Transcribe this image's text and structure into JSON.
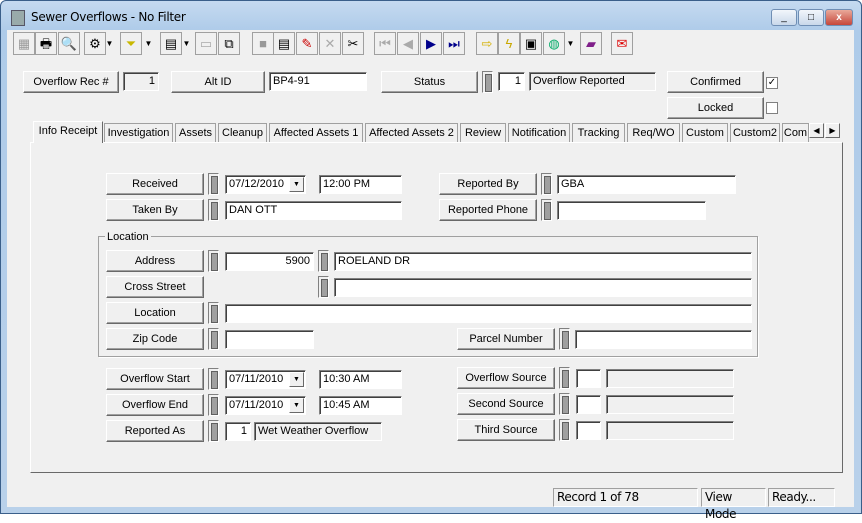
{
  "window": {
    "title": "Sewer Overflows - No Filter",
    "minimize": "_",
    "maximize": "□",
    "close": "x"
  },
  "toolbar": {
    "icons": [
      "grid-icon",
      "print-icon",
      "preview-icon",
      "query-icon",
      "filter-icon",
      "report-icon",
      "export-icon",
      "copy-icon",
      "save-icon",
      "add-record-icon",
      "edit-icon",
      "delete-icon",
      "cut-icon",
      "first-record-icon",
      "previous-record-icon",
      "next-record-icon",
      "last-record-icon",
      "goto-icon",
      "lightning-icon",
      "map-icon",
      "globe-icon",
      "book-icon",
      "mail-icon"
    ],
    "glyphs": [
      "▦",
      "🖶",
      "🔍",
      "⚙",
      "▼",
      "⏷",
      "▼",
      "▤",
      "▼",
      "▭",
      "⧉",
      "■",
      "▤",
      "✎",
      "✕",
      "✂",
      "⏮",
      "◀",
      "▶",
      "⏭",
      "⇨",
      "ϟ",
      "▣",
      "◍",
      "▼",
      "▰",
      "✉"
    ]
  },
  "header": {
    "rec_label": "Overflow Rec #",
    "rec_value": "1",
    "altid_label": "Alt ID",
    "altid_value": "BP4-91",
    "status_label": "Status",
    "status_code": "1",
    "status_text": "Overflow Reported",
    "confirmed_label": "Confirmed",
    "confirmed_checked": true,
    "check_mark": "✓",
    "locked_label": "Locked",
    "locked_checked": false
  },
  "tabs": [
    "Info Receipt",
    "Investigation",
    "Assets",
    "Cleanup",
    "Affected Assets 1",
    "Affected Assets 2",
    "Review",
    "Notification",
    "Tracking",
    "Req/WO",
    "Custom",
    "Custom2",
    "Com"
  ],
  "tab_scroll": {
    "left": "◀",
    "right": "▶"
  },
  "info": {
    "received_label": "Received",
    "received_date": "07/12/2010",
    "received_time": "12:00 PM",
    "taken_by_label": "Taken By",
    "taken_by": "DAN OTT",
    "reported_by_label": "Reported By",
    "reported_by": "GBA",
    "reported_phone_label": "Reported Phone",
    "reported_phone": "",
    "location_group": "Location",
    "address_label": "Address",
    "address_number": "5900",
    "address_street": "ROELAND DR",
    "cross_street_label": "Cross Street",
    "cross_street": "",
    "location_label": "Location",
    "location": "",
    "zip_label": "Zip Code",
    "zip": "",
    "parcel_label": "Parcel Number",
    "parcel": "",
    "start_label": "Overflow Start",
    "start_date": "07/11/2010",
    "start_time": "10:30 AM",
    "end_label": "Overflow End",
    "end_date": "07/11/2010",
    "end_time": "10:45 AM",
    "reported_as_label": "Reported As",
    "reported_as_code": "1",
    "reported_as_text": "Wet Weather Overflow",
    "source_label": "Overflow Source",
    "second_source_label": "Second Source",
    "third_source_label": "Third Source",
    "dropdown_glyph": "▼"
  },
  "statusbar": {
    "record": "Record 1 of 78",
    "mode": "View Mode",
    "state": "Ready..."
  }
}
